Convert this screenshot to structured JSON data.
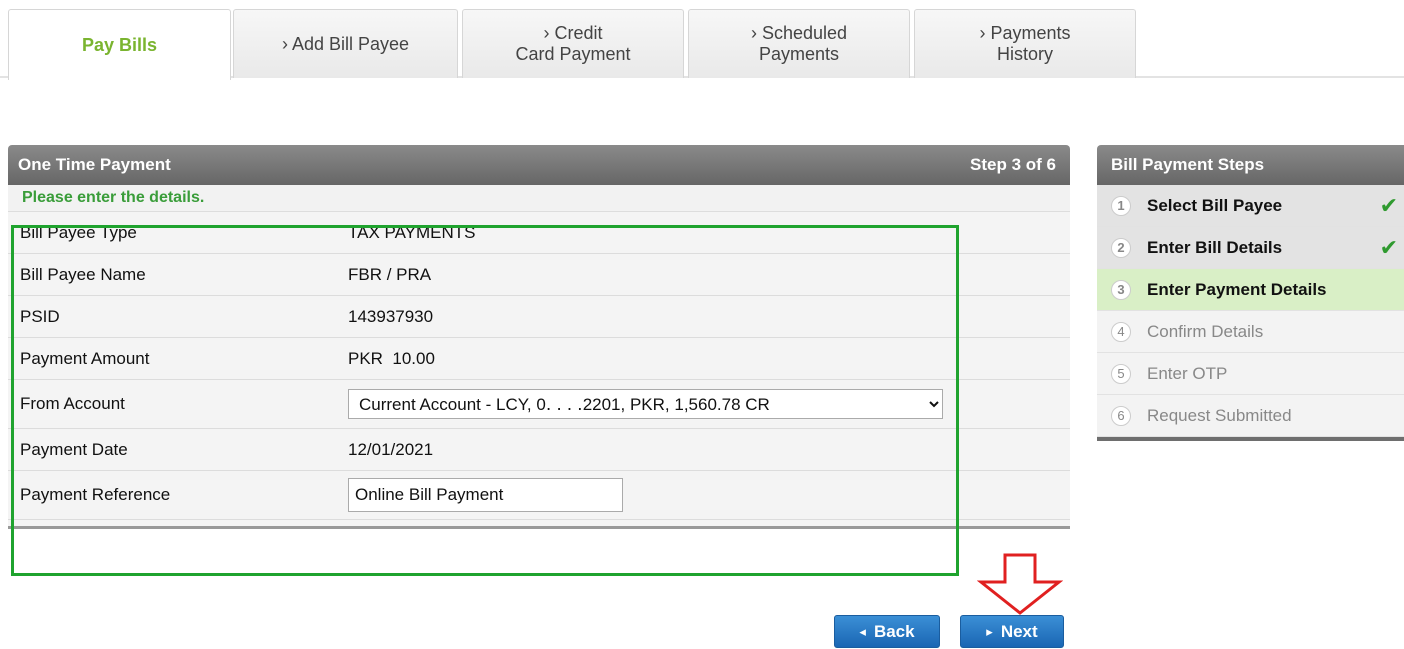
{
  "tabs": [
    {
      "label": "Pay Bills",
      "active": true
    },
    {
      "label": "› Add Bill Payee",
      "active": false
    },
    {
      "label": "› Credit\nCard Payment",
      "active": false
    },
    {
      "label": "› Scheduled\nPayments",
      "active": false
    },
    {
      "label": "› Payments\nHistory",
      "active": false
    }
  ],
  "panel": {
    "title": "One Time Payment",
    "step_indicator": "Step 3 of 6",
    "instruction": "Please enter the details.",
    "fields": {
      "payee_type": {
        "label": "Bill Payee Type",
        "value": "TAX PAYMENTS"
      },
      "payee_name": {
        "label": "Bill Payee Name",
        "value": "FBR / PRA"
      },
      "psid": {
        "label": "PSID",
        "value": "143937930"
      },
      "amount": {
        "label": "Payment Amount",
        "value": "PKR  10.00"
      },
      "from_account": {
        "label": "From Account",
        "value": "Current Account - LCY, 0․ ․ ․ ․2201, PKR,      1,560.78 CR"
      },
      "payment_date": {
        "label": "Payment Date",
        "value": "12/01/2021"
      },
      "reference": {
        "label": "Payment Reference",
        "value": "Online Bill Payment"
      }
    }
  },
  "buttons": {
    "back": "Back",
    "next": "Next"
  },
  "steps": {
    "title": "Bill Payment Steps",
    "items": [
      {
        "num": "1",
        "label": "Select Bill Payee",
        "status": "done"
      },
      {
        "num": "2",
        "label": "Enter Bill Details",
        "status": "done"
      },
      {
        "num": "3",
        "label": "Enter Payment Details",
        "status": "current"
      },
      {
        "num": "4",
        "label": "Confirm Details",
        "status": "pending"
      },
      {
        "num": "5",
        "label": "Enter OTP",
        "status": "pending"
      },
      {
        "num": "6",
        "label": "Request Submitted",
        "status": "pending"
      }
    ]
  },
  "colors": {
    "accent_green": "#7ab42f",
    "highlight_box": "#1fa32e",
    "arrow": "#e02020",
    "button_blue": "#1a66b3"
  },
  "icons": {
    "check": "check-icon",
    "arrow": "down-arrow-icon",
    "chevron": "chevron-icon"
  }
}
